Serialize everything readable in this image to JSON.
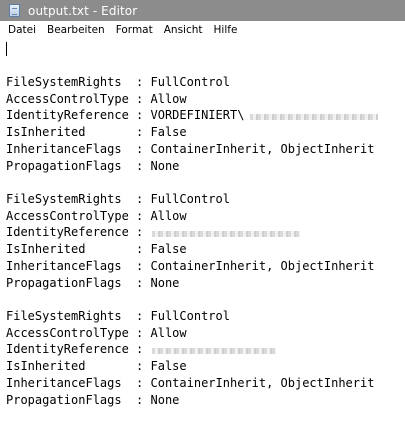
{
  "window": {
    "title": "output.txt - Editor"
  },
  "menu": [
    "Datei",
    "Bearbeiten",
    "Format",
    "Ansicht",
    "Hilfe"
  ],
  "document": {
    "lines": [
      "FileSystemRights  : FullControl",
      "AccessControlType : Allow",
      "IdentityReference : VORDEFINIERT\\",
      "IsInherited       : False",
      "InheritanceFlags  : ContainerInherit, ObjectInherit",
      "PropagationFlags  : None",
      "FileSystemRights  : FullControl",
      "AccessControlType : Allow",
      "IdentityReference : ",
      "IsInherited       : False",
      "InheritanceFlags  : ContainerInherit, ObjectInherit",
      "PropagationFlags  : None",
      "FileSystemRights  : FullControl",
      "AccessControlType : Allow",
      "IdentityReference : ",
      "IsInherited       : False",
      "InheritanceFlags  : ContainerInherit, ObjectInherit",
      "PropagationFlags  : None"
    ]
  }
}
